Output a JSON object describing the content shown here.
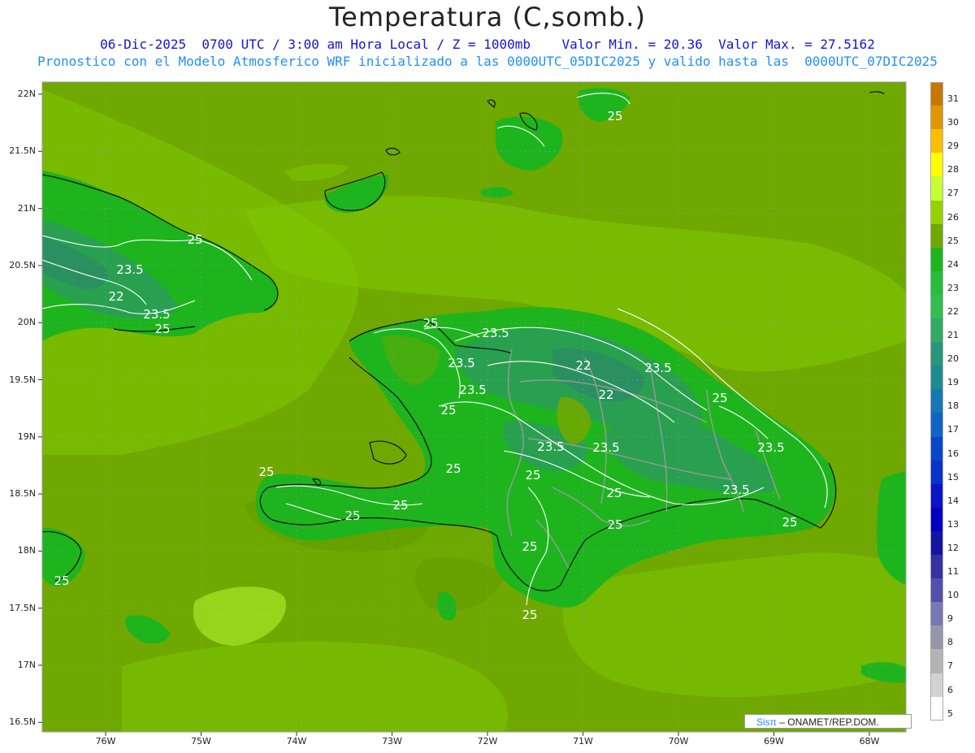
{
  "header": {
    "title": "Temperatura (C,somb.)",
    "line1": "06-Dic-2025  0700 UTC / 3:00 am Hora Local / Z = 1000mb    Valor Min. = 20.36  Valor Max. = 27.5162",
    "line2": "Pronostico con el Modelo Atmosferico WRF inicializado a las 0000UTC_05DIC2025 y valido hasta las  0000UTC_07DIC2025"
  },
  "axes": {
    "lat_labels": [
      "22N",
      "21.5N",
      "21N",
      "20.5N",
      "20N",
      "19.5N",
      "19N",
      "18.5N",
      "18N",
      "17.5N",
      "17N",
      "16.5N"
    ],
    "lon_labels": [
      "76W",
      "75W",
      "74W",
      "73W",
      "72W",
      "71W",
      "70W",
      "69W",
      "68W"
    ]
  },
  "colorbar": {
    "labels": [
      "31",
      "30",
      "29",
      "28",
      "27",
      "26",
      "25",
      "24",
      "23",
      "22",
      "21",
      "20",
      "19",
      "18",
      "17",
      "16",
      "15",
      "14",
      "13",
      "12",
      "11",
      "10",
      "9",
      "8",
      "7",
      "6",
      "5"
    ],
    "colors": [
      "#c87800",
      "#e09600",
      "#ffbe00",
      "#ffff00",
      "#c8ff32",
      "#96d200",
      "#6ea800",
      "#1eb41e",
      "#28be3c",
      "#32be50",
      "#32aa64",
      "#289678",
      "#1e8c8c",
      "#1478b4",
      "#0f64c8",
      "#0a46c8",
      "#0a32c8",
      "#0a14c8",
      "#0000c0",
      "#1414a0",
      "#3232a0",
      "#5050aa",
      "#7878b4",
      "#9696aa",
      "#b4b4b4",
      "#d2d2d2",
      "#ffffff"
    ]
  },
  "contour_labels": [
    "25",
    "25",
    "23.5",
    "22",
    "23.5",
    "25",
    "25",
    "23.5",
    "23.5",
    "22",
    "23.5",
    "22",
    "23.5",
    "25",
    "25",
    "23.5",
    "23.5",
    "23.5",
    "25",
    "25",
    "25",
    "25",
    "25",
    "23.5",
    "25",
    "25",
    "25",
    "25",
    "25",
    "25"
  ],
  "credit": {
    "sis": "Sisπ",
    "rest": "– ONAMET/REP.DOM."
  }
}
